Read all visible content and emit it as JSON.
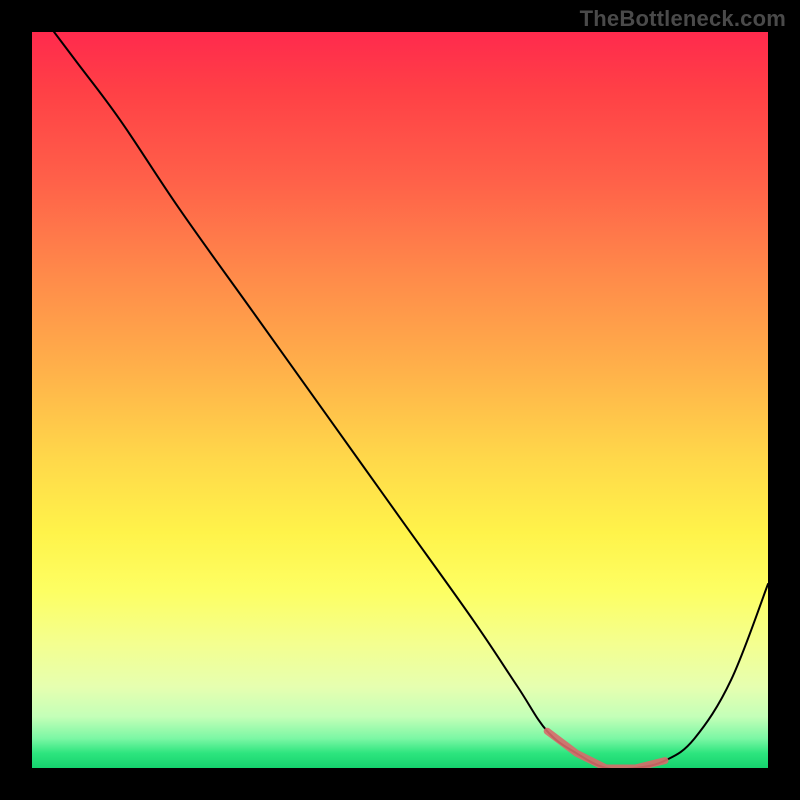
{
  "watermark": "TheBottleneck.com",
  "chart_data": {
    "type": "line",
    "title": "",
    "xlabel": "",
    "ylabel": "",
    "xlim": [
      0,
      100
    ],
    "ylim": [
      0,
      100
    ],
    "grid": false,
    "legend": false,
    "series": [
      {
        "name": "bottleneck-curve",
        "x": [
          3,
          6,
          12,
          20,
          30,
          40,
          50,
          60,
          66,
          70,
          74,
          78,
          82,
          86,
          90,
          95,
          100
        ],
        "values": [
          100,
          96,
          88,
          76,
          62,
          48,
          34,
          20,
          11,
          5,
          2,
          0,
          0,
          1,
          4,
          12,
          25
        ]
      }
    ],
    "highlight_region": {
      "x_start": 70,
      "x_end": 88,
      "description": "bottom flat region markers"
    },
    "background_gradient": {
      "top_color": "#ff2a4d",
      "mid_colors": [
        "#ff8a4a",
        "#ffd84a",
        "#fdff63"
      ],
      "bottom_color": "#15d26e"
    }
  }
}
